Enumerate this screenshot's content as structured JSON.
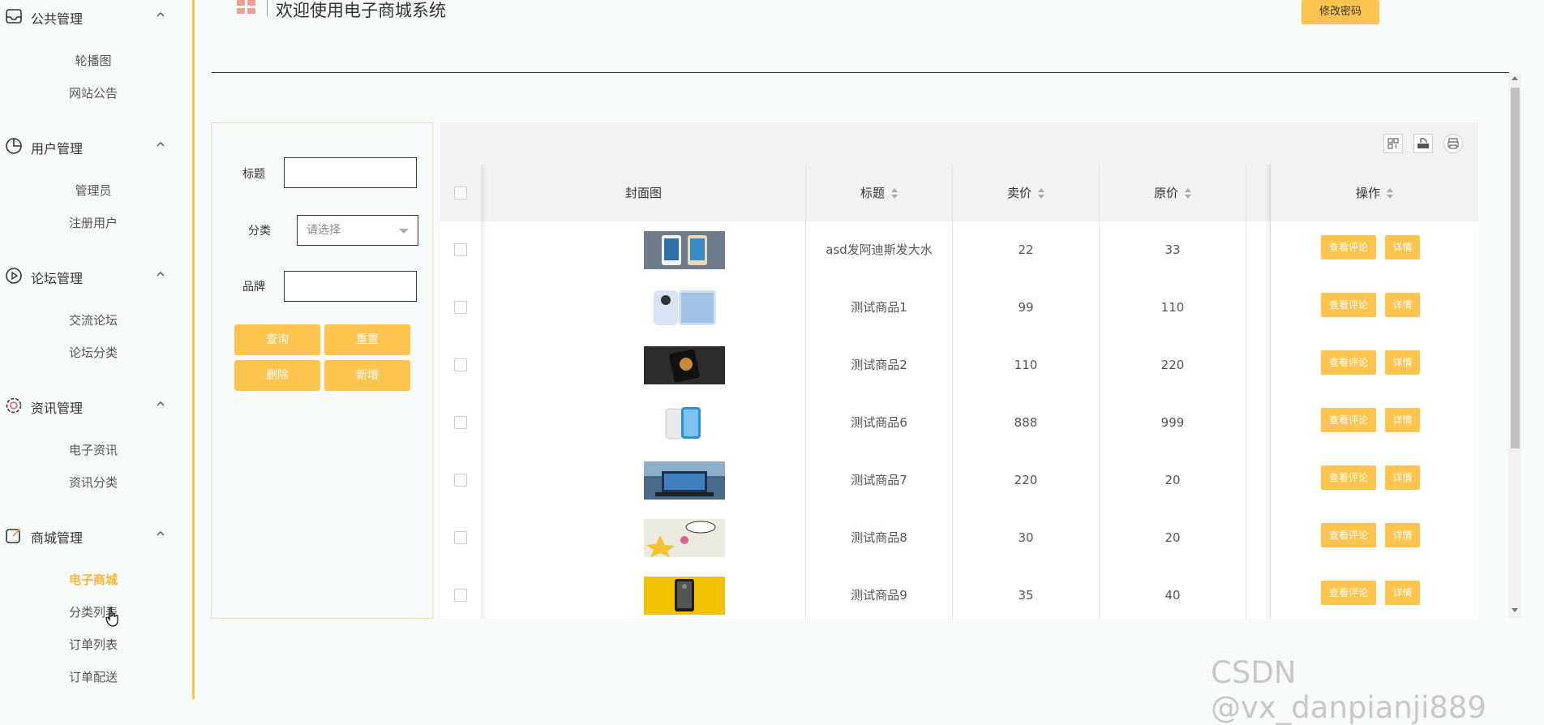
{
  "sidebar": {
    "groups": [
      {
        "label": "公共管理",
        "items": [
          "轮播图",
          "网站公告"
        ]
      },
      {
        "label": "用户管理",
        "items": [
          "管理员",
          "注册用户"
        ]
      },
      {
        "label": "论坛管理",
        "items": [
          "交流论坛",
          "论坛分类"
        ]
      },
      {
        "label": "资讯管理",
        "items": [
          "电子资讯",
          "资讯分类"
        ]
      },
      {
        "label": "商城管理",
        "items": [
          "电子商城",
          "分类列表",
          "订单列表",
          "订单配送"
        ]
      }
    ],
    "active_item": "电子商城"
  },
  "header": {
    "title": "欢迎使用电子商城系统",
    "change_password": "修改密码"
  },
  "search": {
    "title_label": "标题",
    "category_label": "分类",
    "category_placeholder": "请选择",
    "brand_label": "品牌",
    "query": "查询",
    "reset": "重置",
    "delete": "删除",
    "add": "新增"
  },
  "table": {
    "columns": {
      "cover": "封面图",
      "title": "标题",
      "price": "卖价",
      "original": "原价",
      "actions": "操作"
    },
    "rows": [
      {
        "title": "asd发阿迪斯发大水",
        "price": "22",
        "original": "33"
      },
      {
        "title": "测试商品1",
        "price": "99",
        "original": "110"
      },
      {
        "title": "测试商品2",
        "price": "110",
        "original": "220"
      },
      {
        "title": "测试商品6",
        "price": "888",
        "original": "999"
      },
      {
        "title": "测试商品7",
        "price": "220",
        "original": "20"
      },
      {
        "title": "测试商品8",
        "price": "30",
        "original": "20"
      },
      {
        "title": "测试商品9",
        "price": "35",
        "original": "40"
      }
    ],
    "view_comments": "查看评论",
    "details": "详情"
  },
  "toolbar_icons": [
    "columns-icon",
    "export-icon",
    "print-icon"
  ],
  "watermark": "CSDN @vx_danpianji889",
  "colors": {
    "accent": "#ffc44d",
    "active_text": "#ffb43c"
  }
}
